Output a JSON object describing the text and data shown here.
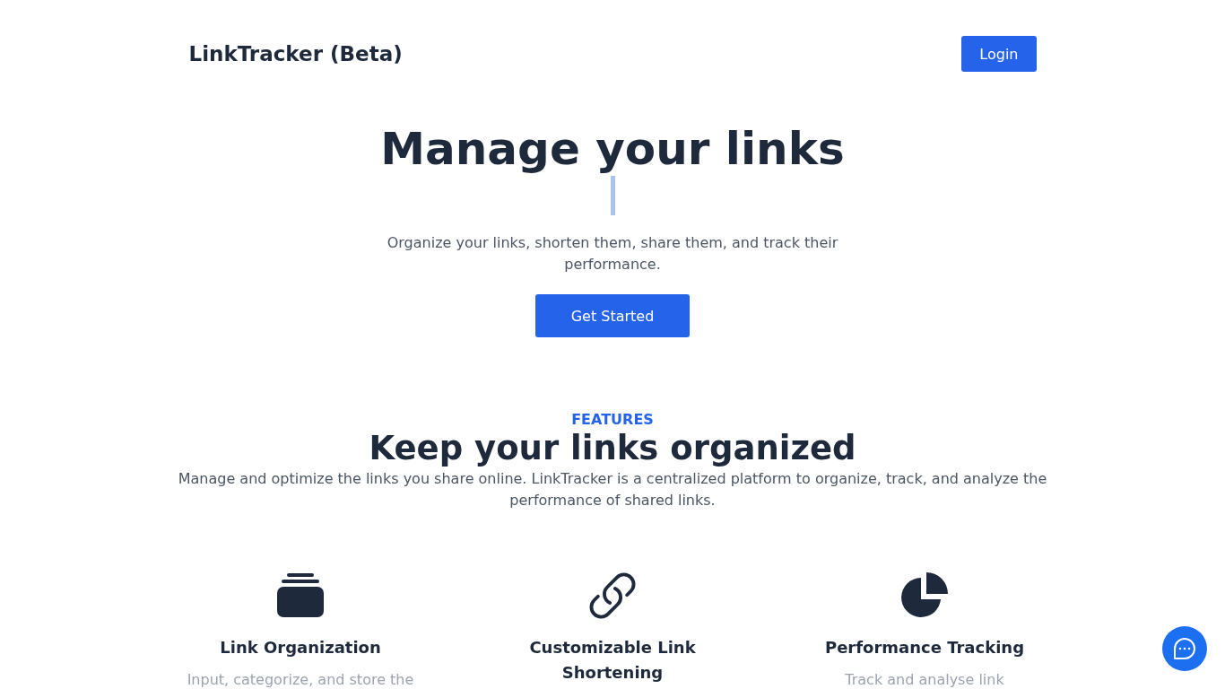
{
  "header": {
    "brand": "LinkTracker (Beta)",
    "login_button": "Login"
  },
  "hero": {
    "title": "Manage your links",
    "text_cursor": true,
    "subtitle": "Organize your links, shorten them, share them, and track their performance.",
    "cta_button": "Get Started"
  },
  "features": {
    "eyebrow": "FEATURES",
    "title": "Keep your links organized",
    "description": "Manage and optimize the links you share online. LinkTracker is a centralized platform to organize, track, and analyze the performance of shared links.",
    "items": [
      {
        "kind": "stack",
        "title": "Link Organization",
        "description": "Input, categorize, and store the"
      },
      {
        "kind": "link",
        "title": "Customizable Link Shortening"
      },
      {
        "kind": "pie",
        "title": "Performance Tracking",
        "description": "Track and analyse link"
      }
    ]
  },
  "chat_button": {
    "kind": "chat"
  }
}
